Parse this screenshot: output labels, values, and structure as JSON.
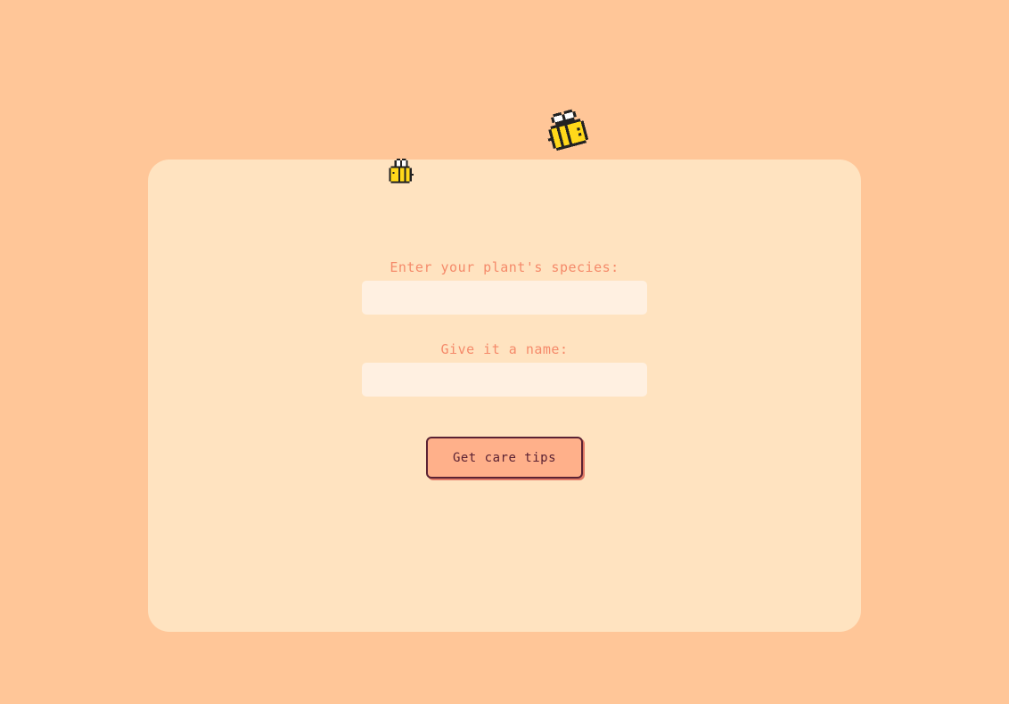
{
  "form": {
    "species_label": "Enter your plant's species:",
    "species_value": "",
    "name_label": "Give it a name:",
    "name_value": "",
    "submit_label": "Get care tips"
  },
  "decorations": {
    "icons": [
      "bee-icon",
      "bee-icon"
    ]
  },
  "colors": {
    "page_background": "#ffc698",
    "card_background": "#ffe3c0",
    "label_text": "#f58a6a",
    "input_background": "#fff0e1",
    "button_background": "#ffb08a",
    "button_border": "#5b2233",
    "bee_yellow": "#ffd81a"
  }
}
